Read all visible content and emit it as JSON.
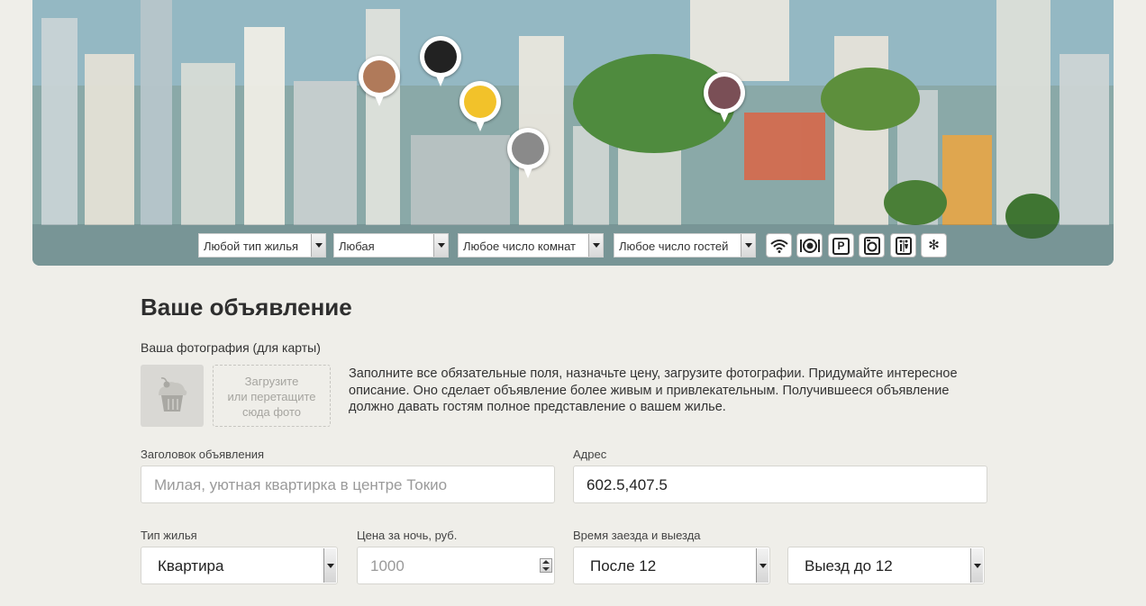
{
  "filters": {
    "housing_type": "Любой тип жилья",
    "any": "Любая",
    "rooms": "Любое число комнат",
    "guests": "Любое число гостей",
    "amenities": [
      "wifi-icon",
      "dining-icon",
      "parking-icon",
      "washer-icon",
      "restroom-icon",
      "snowflake-icon"
    ],
    "parking_glyph": "P"
  },
  "form": {
    "title": "Ваше объявление",
    "photo_label": "Ваша фотография (для карты)",
    "upload_line1": "Загрузите",
    "upload_line2": "или перетащите",
    "upload_line3": "сюда фото",
    "hint": "Заполните все обязательные поля, назначьте цену, загрузите фотографии. Придумайте интересное описание. Оно сделает объявление более живым и привлекательным. Получившееся объявление должно давать гостям полное представление о вашем жилье.",
    "listing_title_label": "Заголовок объявления",
    "listing_title_placeholder": "Милая, уютная квартирка в центре Токио",
    "address_label": "Адрес",
    "address_value": "602.5,407.5",
    "type_label": "Тип жилья",
    "type_value": "Квартира",
    "price_label": "Цена за ночь, руб.",
    "price_placeholder": "1000",
    "time_label": "Время заезда и выезда",
    "checkin_value": "После 12",
    "checkout_value": "Выезд до 12"
  },
  "colors": {
    "background": "#efeee9",
    "field_border": "#d6d5d0"
  }
}
